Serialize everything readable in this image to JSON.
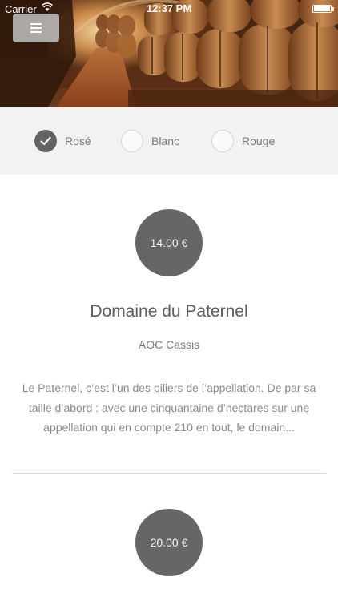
{
  "status_bar": {
    "carrier": "Carrier",
    "time": "12:37 PM"
  },
  "header": {
    "menu_icon": "hamburger-menu-icon",
    "hero_image": "wine-cellar-barrels"
  },
  "filters": [
    {
      "label": "Rosé",
      "checked": true
    },
    {
      "label": "Blanc",
      "checked": false
    },
    {
      "label": "Rouge",
      "checked": false
    }
  ],
  "wines": [
    {
      "price": "14.00 €",
      "name": "Domaine du Paternel",
      "appellation": "AOC Cassis",
      "description": "Le Paternel, c’est l’un des piliers de l’appellation. De par sa taille d’abord : avec une cinquantaine d’hectares sur une appellation qui en compte 210 en tout, le domain..."
    },
    {
      "price": "20.00 €"
    }
  ],
  "colors": {
    "filter_bar_bg": "#f2f2f2",
    "badge_bg": "#666666",
    "checked_bg": "#636363"
  }
}
